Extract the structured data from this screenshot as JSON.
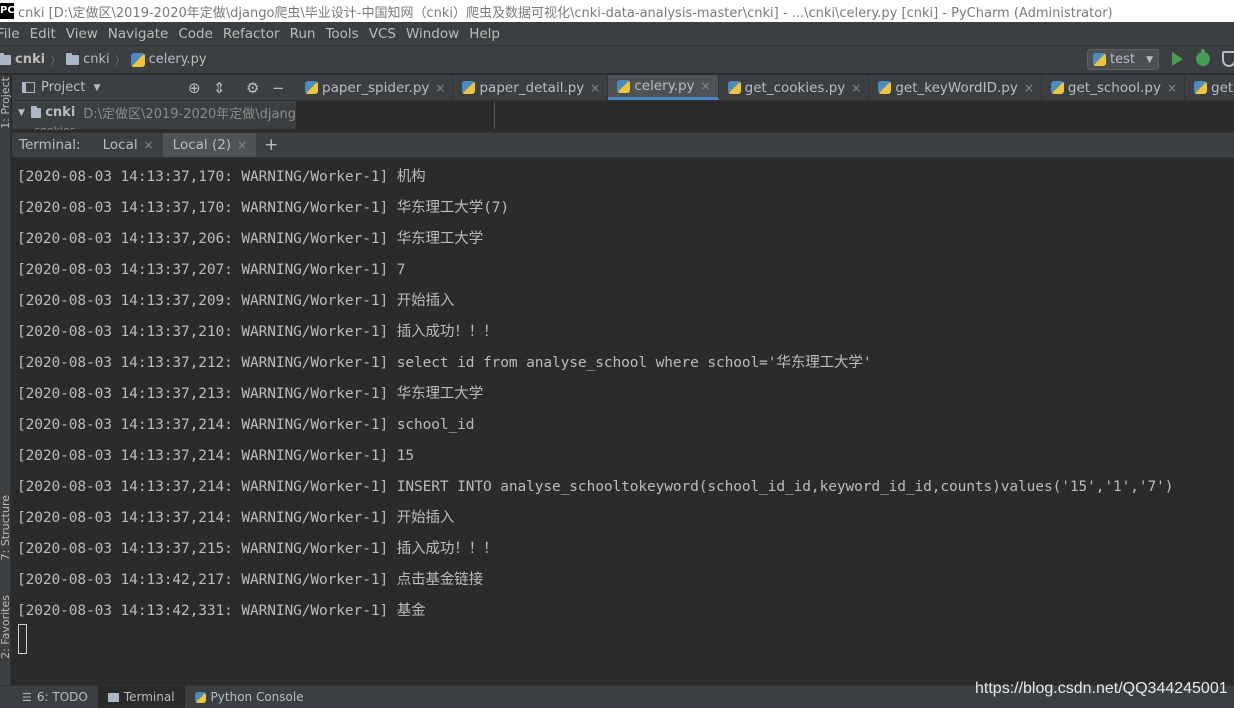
{
  "window": {
    "app_icon": "PC",
    "title": "cnki [D:\\定做区\\2019-2020年定做\\django爬虫\\毕业设计-中国知网（cnki）爬虫及数据可视化\\cnki-data-analysis-master\\cnki] - ...\\cnki\\celery.py [cnki] - PyCharm (Administrator)"
  },
  "menu": [
    "File",
    "Edit",
    "View",
    "Navigate",
    "Code",
    "Refactor",
    "Run",
    "Tools",
    "VCS",
    "Window",
    "Help"
  ],
  "breadcrumb": {
    "project": "cnki",
    "folder": "cnki",
    "file": "celery.py"
  },
  "run_config": {
    "name": "test"
  },
  "project_panel": {
    "title": "Project",
    "tree_root_name": "cnki",
    "tree_root_path": "D:\\定做区\\2019-2020年定做\\djang",
    "partial_row": "cookies"
  },
  "editor_tabs": [
    {
      "label": "paper_spider.py",
      "active": false
    },
    {
      "label": "paper_detail.py",
      "active": false
    },
    {
      "label": "celery.py",
      "active": true
    },
    {
      "label": "get_cookies.py",
      "active": false
    },
    {
      "label": "get_keyWordID.py",
      "active": false
    },
    {
      "label": "get_school.py",
      "active": false
    },
    {
      "label": "get_year.py",
      "active": false
    }
  ],
  "terminal": {
    "label": "Terminal:",
    "tabs": [
      {
        "label": "Local",
        "active": false
      },
      {
        "label": "Local (2)",
        "active": true
      }
    ],
    "lines": [
      "[2020-08-03 14:13:37,170: WARNING/Worker-1] 机构",
      "[2020-08-03 14:13:37,170: WARNING/Worker-1] 华东理工大学(7)",
      "[2020-08-03 14:13:37,206: WARNING/Worker-1] 华东理工大学",
      "[2020-08-03 14:13:37,207: WARNING/Worker-1] 7",
      "[2020-08-03 14:13:37,209: WARNING/Worker-1] 开始插入",
      "[2020-08-03 14:13:37,210: WARNING/Worker-1] 插入成功！！！",
      "[2020-08-03 14:13:37,212: WARNING/Worker-1] select id from analyse_school where school='华东理工大学'",
      "[2020-08-03 14:13:37,213: WARNING/Worker-1] 华东理工大学",
      "[2020-08-03 14:13:37,214: WARNING/Worker-1] school_id",
      "[2020-08-03 14:13:37,214: WARNING/Worker-1] 15",
      "[2020-08-03 14:13:37,214: WARNING/Worker-1] INSERT INTO analyse_schooltokeyword(school_id_id,keyword_id_id,counts)values('15','1','7')",
      "[2020-08-03 14:13:37,214: WARNING/Worker-1] 开始插入",
      "[2020-08-03 14:13:37,215: WARNING/Worker-1] 插入成功！！！",
      "[2020-08-03 14:13:42,217: WARNING/Worker-1] 点击基金链接",
      "[2020-08-03 14:13:42,331: WARNING/Worker-1] 基金"
    ]
  },
  "left_stripe": {
    "project": "1: Project",
    "structure": "7: Structure",
    "favorites": "2: Favorites"
  },
  "bottom_tabs": {
    "todo": "6: TODO",
    "terminal": "Terminal",
    "python_console": "Python Console"
  },
  "watermark": "https://blog.csdn.net/QQ344245001",
  "colors": {
    "background": "#2b2b2b",
    "panel": "#3c3f41",
    "active_tab_underline": "#4a88c7",
    "run_green": "#499c54"
  },
  "icons": {
    "run": "run-icon",
    "debug": "debug-icon",
    "coverage": "coverage-icon"
  }
}
